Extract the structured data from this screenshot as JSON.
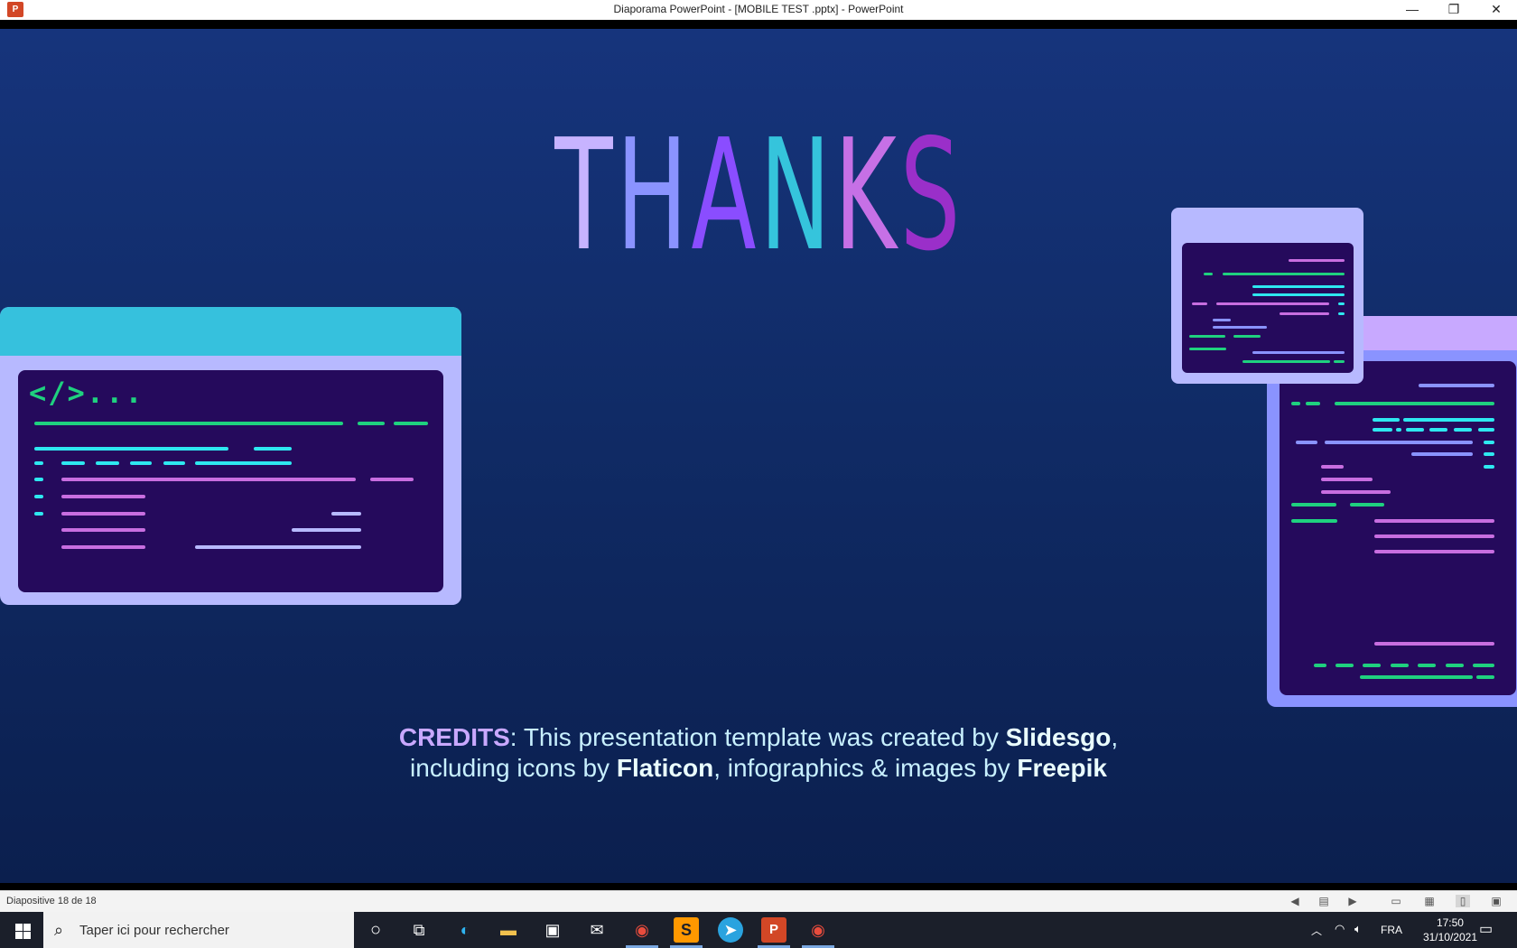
{
  "window": {
    "title": "Diaporama PowerPoint - [MOBILE TEST .pptx] - PowerPoint",
    "app_icon_label": "P",
    "minimize": "—",
    "restore": "❐",
    "close": "✕"
  },
  "slide": {
    "title_letters": [
      {
        "char": "T",
        "color": "#c7b3ff"
      },
      {
        "char": "H",
        "color": "#8a93ff"
      },
      {
        "char": "A",
        "color": "#8a4dff"
      },
      {
        "char": "N",
        "color": "#35c4dc"
      },
      {
        "char": "K",
        "color": "#c670e6"
      },
      {
        "char": "S",
        "color": "#9a2fc9"
      }
    ],
    "credits": {
      "label": "CREDITS",
      "part1": ": This presentation template was created by ",
      "slidesgo": "Slidesgo",
      "part2": ",",
      "part3": "including icons by ",
      "flaticon": "Flaticon",
      "part4": ", infographics & images by ",
      "freepik": "Freepik"
    },
    "left_window_code_glyph": "</>...",
    "colors": {
      "green": "#1fd17f",
      "cyan": "#2ee8f0",
      "pink": "#c86ee0",
      "lavender": "#b7b9ff",
      "screen": "#250a5c",
      "cyan_bar": "#36c1dd",
      "lilac_bar": "#c8a9ff"
    }
  },
  "statusbar": {
    "slide_counter": "Diapositive 18 de 18"
  },
  "taskbar": {
    "search_placeholder": "Taper ici pour rechercher",
    "language": "FRA",
    "time": "17:50",
    "date": "31/10/2021"
  }
}
